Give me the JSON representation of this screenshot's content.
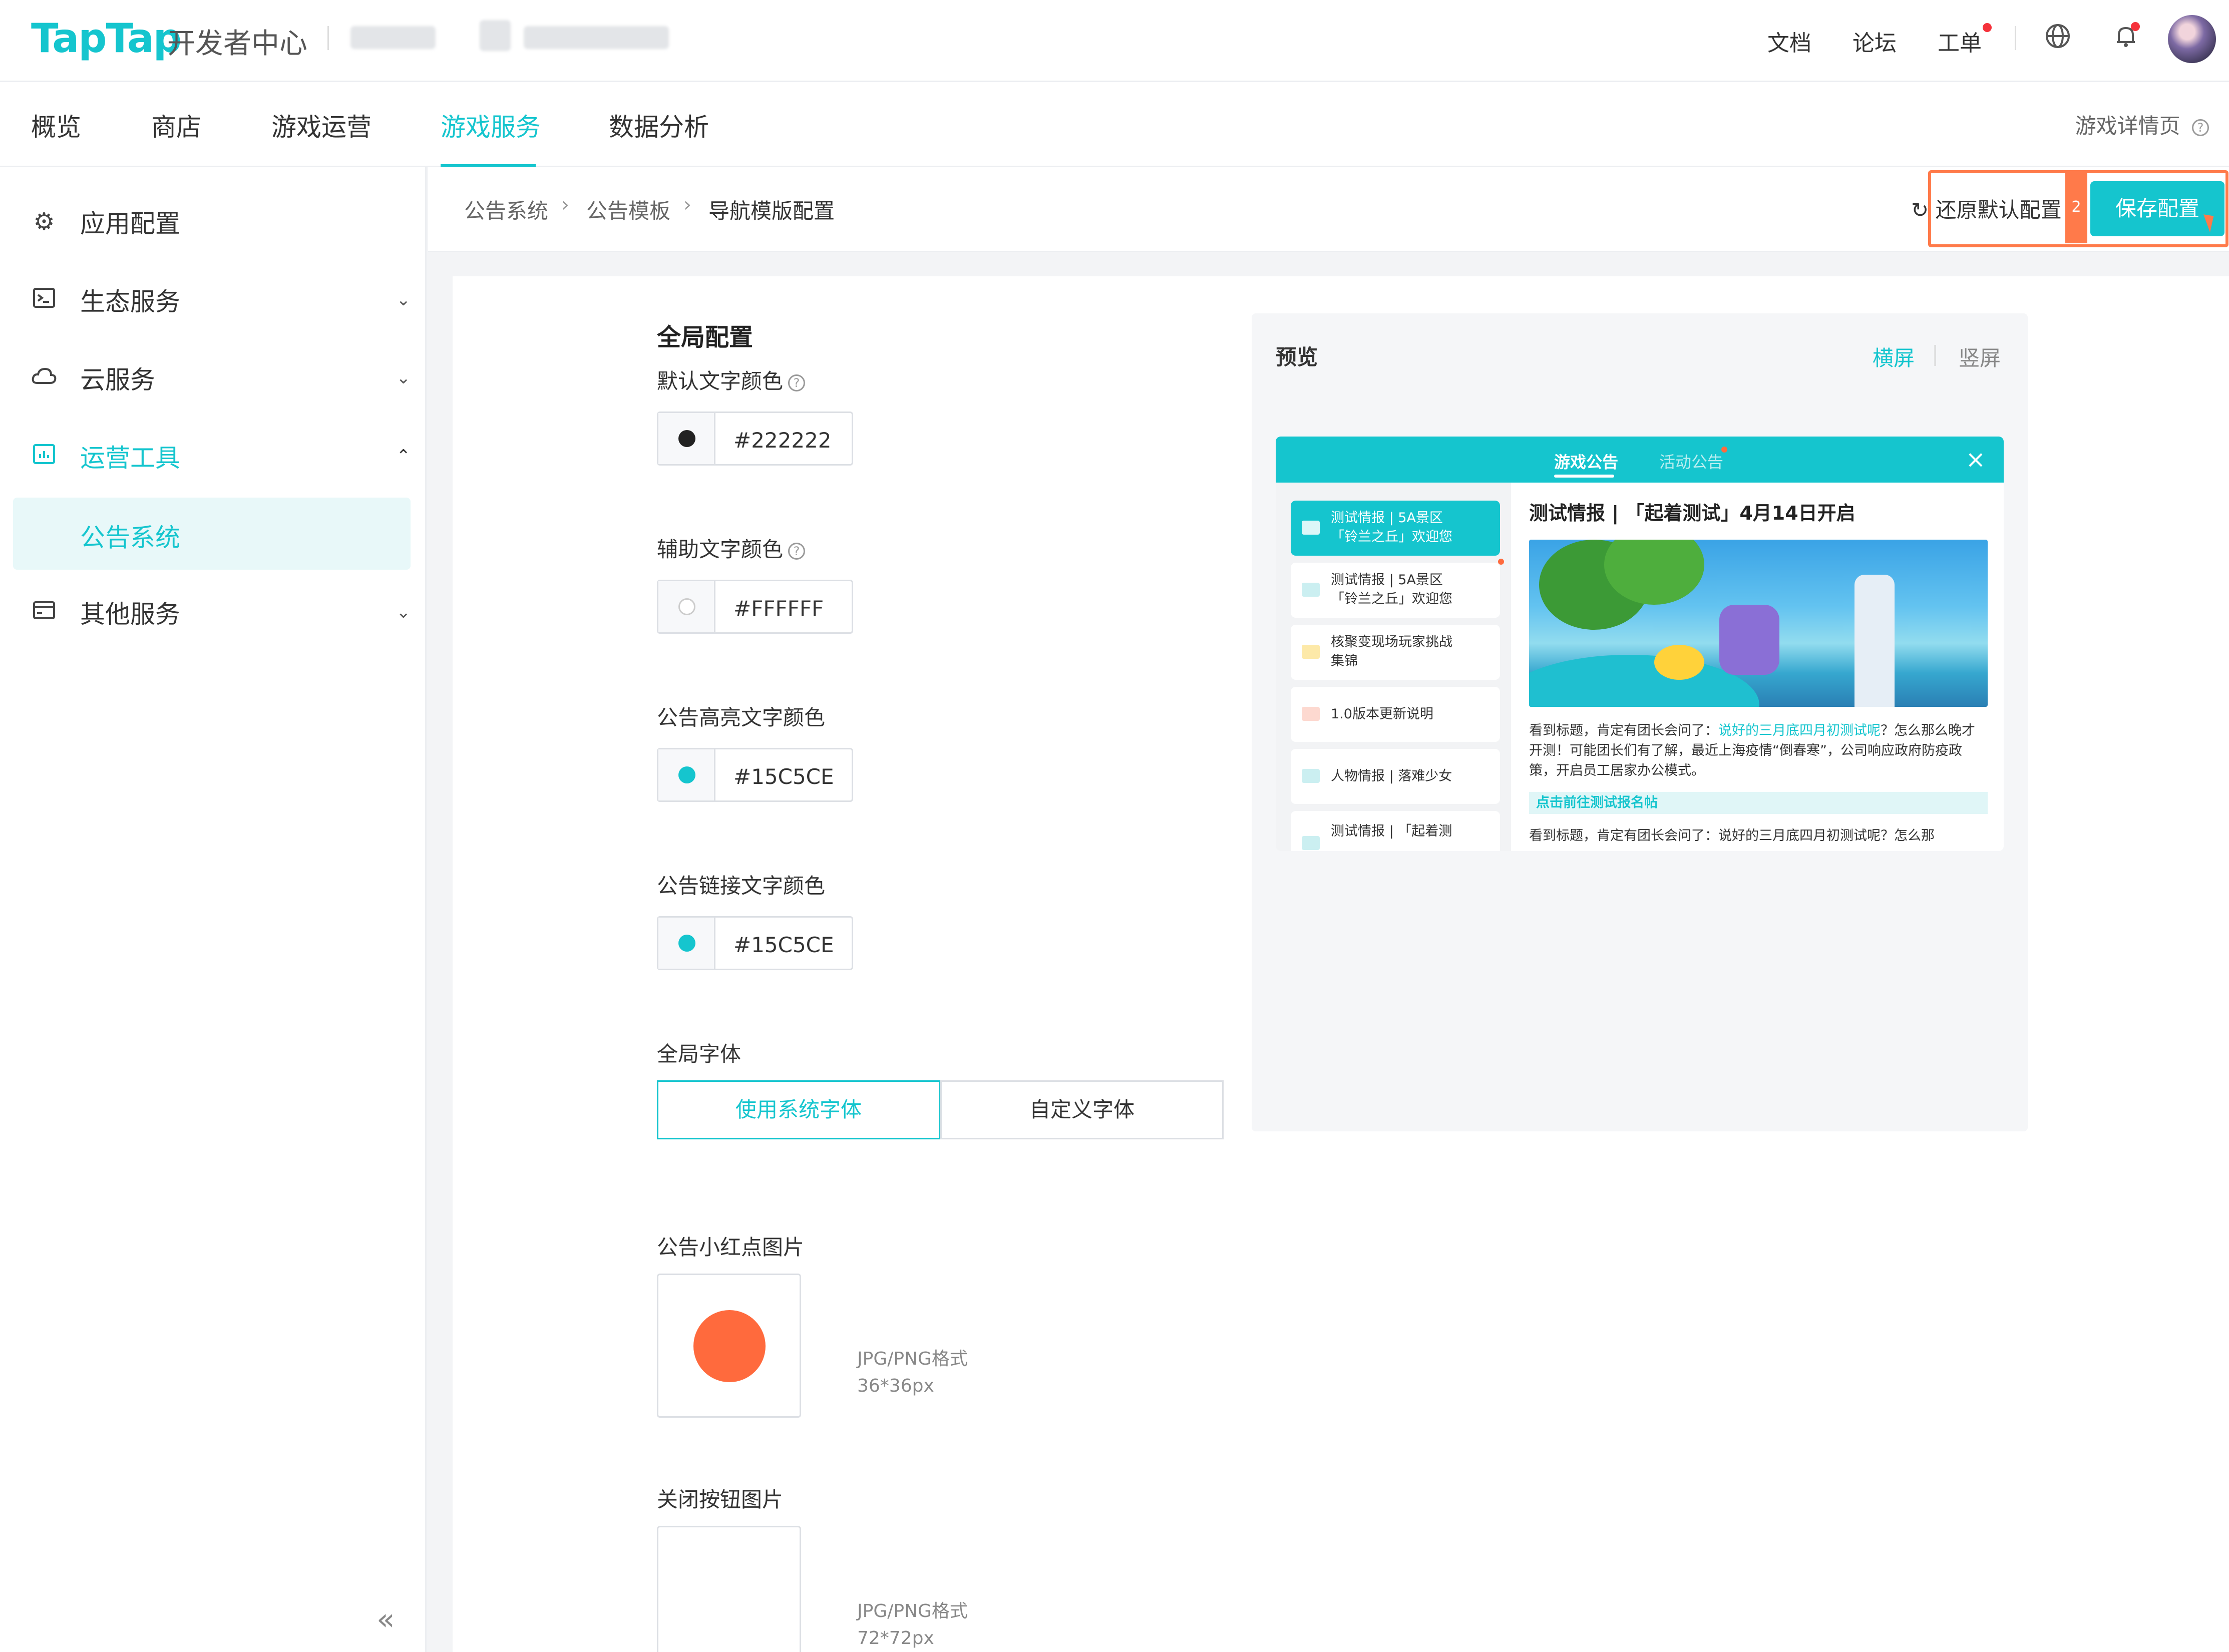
{
  "header": {
    "logo": "TapTap",
    "logo_sub": "开发者中心",
    "links": {
      "docs": "文档",
      "forum": "论坛",
      "tickets": "工单"
    }
  },
  "nav": {
    "tabs": [
      "概览",
      "商店",
      "游戏运营",
      "游戏服务",
      "数据分析"
    ],
    "active": "游戏服务",
    "detail_link": "游戏详情页"
  },
  "sidebar": {
    "items": [
      {
        "label": "应用配置",
        "icon": "gear-icon"
      },
      {
        "label": "生态服务",
        "icon": "terminal-icon"
      },
      {
        "label": "云服务",
        "icon": "cloud-icon"
      },
      {
        "label": "运营工具",
        "icon": "chart-board-icon"
      },
      {
        "label": "其他服务",
        "icon": "card-icon"
      }
    ],
    "sub_active": "公告系统"
  },
  "breadcrumb": [
    "公告系统",
    "公告模板",
    "导航模版配置"
  ],
  "toolbar": {
    "reset_label": "还原默认配置",
    "save_label": "保存配置",
    "step_number": "2"
  },
  "form": {
    "section_title": "全局配置",
    "default_text_color": {
      "label": "默认文字颜色",
      "value": "#222222"
    },
    "aux_text_color": {
      "label": "辅助文字颜色",
      "value": "#FFFFFF"
    },
    "highlight_text_color": {
      "label": "公告高亮文字颜色",
      "value": "#15C5CE"
    },
    "link_text_color": {
      "label": "公告链接文字颜色",
      "value": "#15C5CE"
    },
    "font": {
      "label": "全局字体",
      "options": [
        "使用系统字体",
        "自定义字体"
      ],
      "selected": "使用系统字体"
    },
    "red_dot_image": {
      "label": "公告小红点图片",
      "hint_format": "JPG/PNG格式",
      "hint_size": "36*36px"
    },
    "close_button_image": {
      "label": "关闭按钮图片",
      "hint_format": "JPG/PNG格式",
      "hint_size": "72*72px"
    }
  },
  "preview": {
    "title": "预览",
    "orientation": {
      "landscape": "横屏",
      "portrait": "竖屏",
      "active": "横屏"
    },
    "tabs": [
      "游戏公告",
      "活动公告"
    ],
    "list": [
      {
        "line1": "测试情报 | 5A景区",
        "line2": "「铃兰之丘」欢迎您"
      },
      {
        "line1": "测试情报 | 5A景区",
        "line2": "「铃兰之丘」欢迎您"
      },
      {
        "line1": "核聚变现场玩家挑战",
        "line2": "集锦"
      },
      {
        "line1": "1.0版本更新说明",
        "line2": ""
      },
      {
        "line1": "人物情报 | 落难少女",
        "line2": ""
      },
      {
        "line1": "测试情报 | 「起着测",
        "line2": ""
      }
    ],
    "article_title": "测试情报 | 「起着测试」4月14日开启",
    "body_before": "看到标题，肯定有团长会问了：",
    "body_highlight": "说好的三月底四月初测试呢",
    "body_after": "？怎么那么晚才开测！可能团长们有了解，最近上海疫情“倒春寒”，公司响应政府防疫政策，开启员工居家办公模式。",
    "cta": "点击前往测试报名帖",
    "cut_line": "看到标题，肯定有团长会问了：说好的三月底四月初测试呢？怎么那"
  },
  "colors": {
    "accent": "#15C5CE",
    "highlight_outline": "#FF7A4A",
    "red_dot": "#FF6A3D"
  }
}
